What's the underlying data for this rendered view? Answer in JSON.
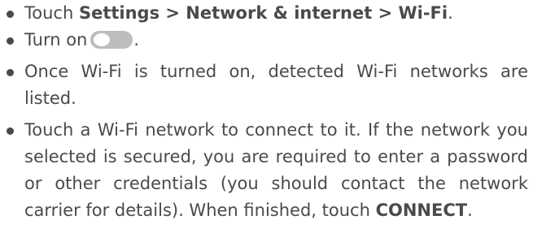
{
  "steps": [
    {
      "prefix": "Touch ",
      "path": "Settings > Network & internet > Wi-Fi",
      "suffix": "."
    },
    {
      "prefix": "Turn on",
      "toggle_icon": "toggle-switch-off-icon",
      "suffix": "."
    },
    {
      "text": "Once Wi-Fi is turned on, detected Wi-Fi networks are listed."
    },
    {
      "text": "Touch a Wi-Fi network to connect to it. If the network you selected is secured, you are required to enter a password or other credentials (you should contact the network carrier for details). When finished, touch ",
      "action": "CONNECT",
      "suffix": "."
    }
  ],
  "colors": {
    "text": "#4a4a4a",
    "toggle_track": "#bdbdbd",
    "toggle_knob": "#ffffff"
  }
}
